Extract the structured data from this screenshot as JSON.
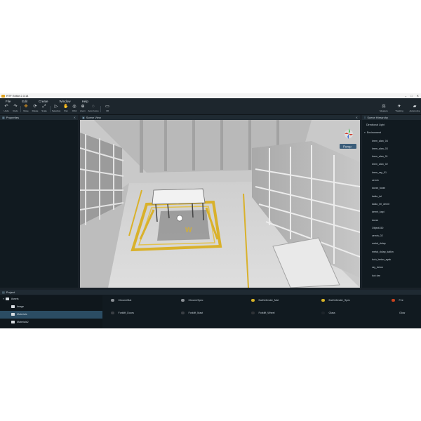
{
  "window": {
    "title": "RTF Editor 2.3.14"
  },
  "menu": [
    "File",
    "Edit",
    "Create",
    "Window",
    "Help"
  ],
  "toolbar": {
    "tools": [
      {
        "label": "Undo",
        "icon": "undo-icon",
        "glyph": "↶"
      },
      {
        "label": "Redo",
        "icon": "redo-icon",
        "glyph": "↷"
      },
      {
        "label": "Move",
        "icon": "move-icon",
        "glyph": "✥"
      },
      {
        "label": "Rotate",
        "icon": "rotate-icon",
        "glyph": "⟳"
      },
      {
        "label": "Scale",
        "icon": "scale-icon",
        "glyph": "⤢"
      },
      {
        "label": "Selection",
        "icon": "selection-icon",
        "glyph": "▷"
      },
      {
        "label": "Pan",
        "icon": "pan-icon",
        "glyph": "✋"
      },
      {
        "label": "Orbit",
        "icon": "orbit-icon",
        "glyph": "◎"
      },
      {
        "label": "Zoom",
        "icon": "zoom-icon",
        "glyph": "⊕"
      },
      {
        "label": "Auto Focus",
        "icon": "focus-icon",
        "glyph": "◌"
      },
      {
        "label": "VR",
        "icon": "vr-icon",
        "glyph": "▭"
      }
    ],
    "right_tools": [
      {
        "label": "Measure",
        "icon": "measure-icon",
        "glyph": "⚖"
      },
      {
        "label": "Tracking",
        "icon": "tracking-icon",
        "glyph": "✈"
      },
      {
        "label": "Automotive",
        "icon": "car-icon",
        "glyph": "🚗"
      }
    ]
  },
  "panels": {
    "properties": "Properties",
    "scene_view": "Scene View",
    "scene_hierarchy": "Scene Hierarchy",
    "project": "Project"
  },
  "viewport": {
    "camera_mode": "Persp"
  },
  "hierarchy": {
    "root": "Directional Light",
    "group": "Environment",
    "items": [
      "krem_alan_04",
      "krem_alan_03",
      "krem_alan_01",
      "krem_alan_02",
      "krem_ray_01",
      "zemin",
      "duvar_turan",
      "kalko_tel",
      "kalko_tel_demir",
      "demir_kapi",
      "duvar",
      "Object150",
      "zemin_02",
      "metal_dolap",
      "metal_dolap_kalkin",
      "kulu_beton_ayak",
      "ray_beton",
      "kuk dar"
    ]
  },
  "project": {
    "tree": [
      {
        "label": "Assets",
        "level": 0
      },
      {
        "label": "Image",
        "level": 1
      },
      {
        "label": "Materials",
        "level": 1,
        "selected": true
      },
      {
        "label": "Materials2",
        "level": 1
      }
    ],
    "materials": [
      {
        "label": "ChromeMat",
        "color": "#8a8f94"
      },
      {
        "label": "ChromeSpec",
        "color": "#8a8f94"
      },
      {
        "label": "EarDefender_Mat",
        "color": "#d6b227"
      },
      {
        "label": "EarDefender_Spec",
        "color": "#d6b227"
      },
      {
        "label": "Fire",
        "color": "#c9431e"
      },
      {
        "label": "Forklift_Doors",
        "color": "#3a3f44"
      },
      {
        "label": "Forklift_Mast",
        "color": "#3a3f44"
      },
      {
        "label": "Forklift_Wheel",
        "color": "#2e3236"
      },
      {
        "label": "Glass",
        "color": "#1d242a"
      },
      {
        "label": "Glow",
        "color": ""
      }
    ]
  }
}
